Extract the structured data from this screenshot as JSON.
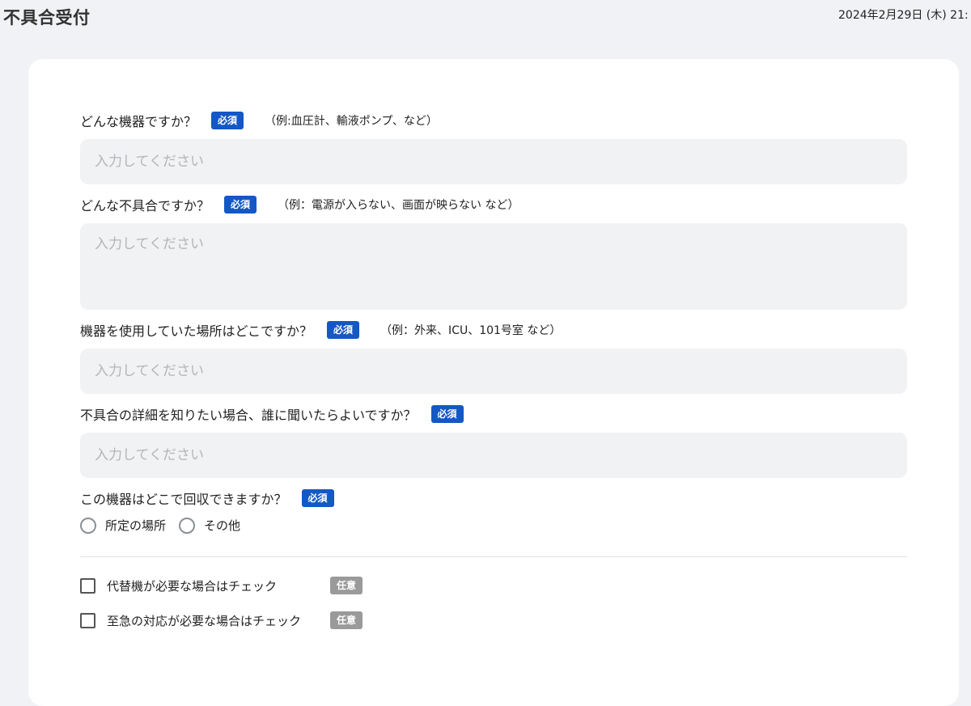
{
  "header": {
    "title": "不具合受付",
    "datetime": "2024年2月29日 (木) 21:"
  },
  "form": {
    "required_badge": "必須",
    "optional_badge": "任意",
    "placeholder": "入力してください",
    "device": {
      "label": "どんな機器ですか？",
      "hint": "（例:血圧計、輸液ポンプ、など）"
    },
    "issue": {
      "label": "どんな不具合ですか？",
      "hint": "（例：電源が入らない、画面が映らない など）"
    },
    "location": {
      "label": "機器を使用していた場所はどこですか？",
      "hint": "（例：外来、ICU、101号室 など）"
    },
    "contact": {
      "label": "不具合の詳細を知りたい場合、誰に聞いたらよいですか？"
    },
    "pickup": {
      "label": "この機器はどこで回収できますか？",
      "options": [
        "所定の場所",
        "その他"
      ]
    },
    "checks": [
      {
        "label": "代替機が必要な場合はチェック",
        "checked": false
      },
      {
        "label": "至急の対応が必要な場合はチェック",
        "checked": false
      }
    ]
  },
  "colors": {
    "required_badge": "#1358c4",
    "optional_badge": "#9a9a9a",
    "input_bg": "#f1f2f4",
    "page_bg": "#f0f2f5"
  }
}
